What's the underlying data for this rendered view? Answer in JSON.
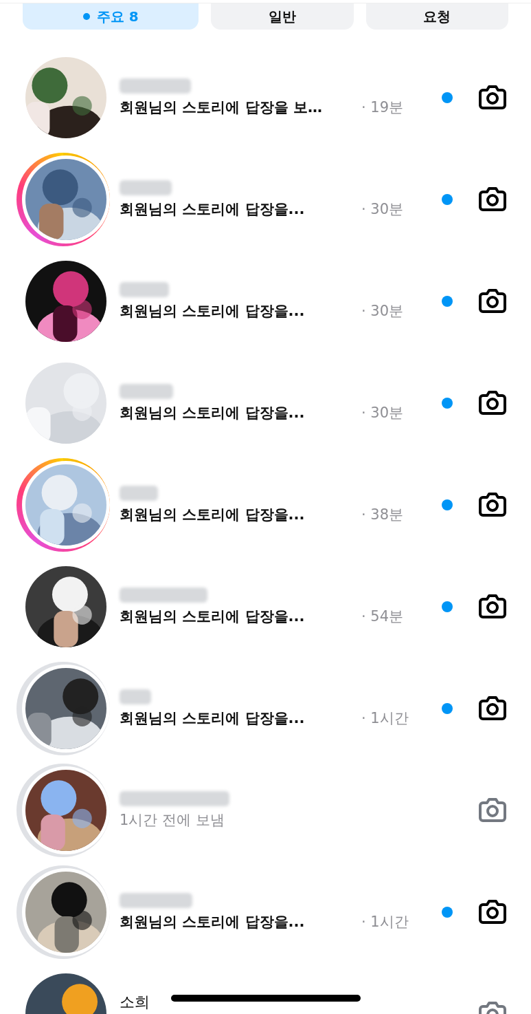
{
  "tabs": [
    {
      "label": "주요 8",
      "selected": true,
      "dot": true
    },
    {
      "label": "일반",
      "selected": false,
      "dot": false
    },
    {
      "label": "요청",
      "selected": false,
      "dot": false
    }
  ],
  "threads": [
    {
      "name_hidden": true,
      "story": false,
      "viewed": false,
      "preview": "회원님의 스토리에 답장을 보…",
      "time": "· 19분",
      "unread": true
    },
    {
      "name_hidden": true,
      "story": true,
      "viewed": false,
      "preview": "회원님의 스토리에 답장을...",
      "time": "· 30분",
      "unread": true
    },
    {
      "name_hidden": true,
      "story": false,
      "viewed": false,
      "preview": "회원님의 스토리에 답장을...",
      "time": "· 30분",
      "unread": true
    },
    {
      "name_hidden": true,
      "story": false,
      "viewed": false,
      "preview": "회원님의 스토리에 답장을...",
      "time": "· 30분",
      "unread": true
    },
    {
      "name_hidden": true,
      "story": true,
      "viewed": false,
      "preview": "회원님의 스토리에 답장을...",
      "time": "· 38분",
      "unread": true
    },
    {
      "name_hidden": true,
      "story": false,
      "viewed": false,
      "preview": "회원님의 스토리에 답장을...",
      "time": "· 54분",
      "unread": true
    },
    {
      "name_hidden": true,
      "story": true,
      "viewed": true,
      "preview": "회원님의 스토리에 답장을...",
      "time": "· 1시간",
      "unread": true
    },
    {
      "name_hidden": true,
      "story": true,
      "viewed": true,
      "preview": "1시간 전에 보냄",
      "unread": false
    },
    {
      "name_hidden": true,
      "story": true,
      "viewed": true,
      "preview": "회원님의 스토리에 답장을...",
      "time": "· 1시간",
      "unread": true
    },
    {
      "name": "소희",
      "story": false,
      "viewed": false,
      "unread": false
    }
  ]
}
